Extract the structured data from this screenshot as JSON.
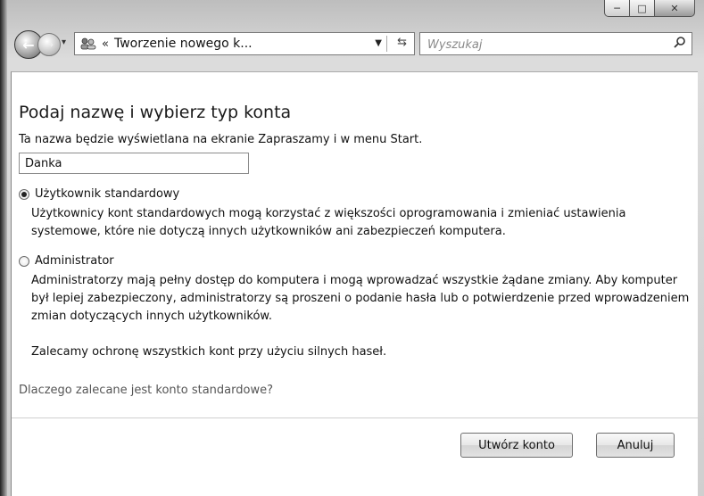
{
  "window": {
    "caption_buttons": {
      "minimize_icon": "minimize-icon",
      "maximize_icon": "maximize-icon",
      "close_icon": "close-icon"
    }
  },
  "navbar": {
    "back_icon": "back-arrow-icon",
    "forward_icon": "forward-arrow-icon",
    "address_breadcrumb_chevron": "«",
    "address_text": "Tworzenie nowego k...",
    "search_placeholder": "Wyszukaj"
  },
  "content": {
    "title": "Podaj nazwę i wybierz typ konta",
    "name_description": "Ta nazwa będzie wyświetlana na ekranie Zapraszamy i w menu Start.",
    "name_value": "Danka",
    "options": [
      {
        "label": "Użytkownik standardowy",
        "selected": true,
        "description": "Użytkownicy kont standardowych mogą korzystać z większości oprogramowania i zmieniać ustawienia systemowe, które nie dotyczą innych użytkowników ani zabezpieczeń komputera."
      },
      {
        "label": "Administrator",
        "selected": false,
        "description": "Administratorzy mają pełny dostęp do komputera i mogą wprowadzać wszystkie żądane zmiany. Aby komputer był lepiej zabezpieczony, administratorzy są proszeni o podanie hasła lub o potwierdzenie przed wprowadzeniem zmian dotyczących innych użytkowników.",
        "note": "Zalecamy ochronę wszystkich kont przy użyciu silnych haseł."
      }
    ],
    "help_link": "Dlaczego zalecane jest konto standardowe?"
  },
  "footer": {
    "create_label": "Utwórz konto",
    "cancel_label": "Anuluj"
  }
}
